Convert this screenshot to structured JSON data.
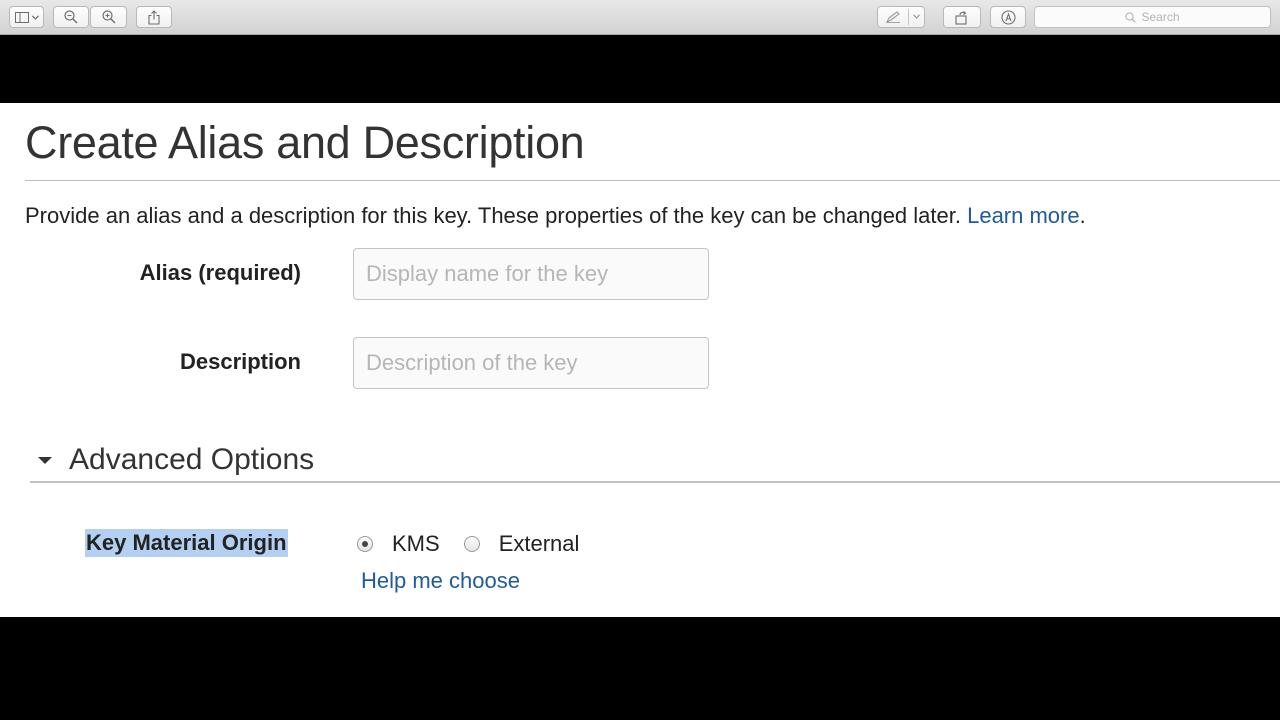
{
  "toolbar": {
    "icons": [
      "sidebar-icon",
      "chevron-down-icon",
      "zoom-out-icon",
      "zoom-in-icon",
      "share-icon",
      "markup-pen-icon",
      "rotate-icon",
      "annotate-icon"
    ],
    "search_placeholder": "Search"
  },
  "page": {
    "title": "Create Alias and Description",
    "intro_text": "Provide an alias and a description for this key. These properties of the key can be changed later. ",
    "learn_more_link": "Learn more",
    "intro_period": ".",
    "fields": {
      "alias_label": "Alias (required)",
      "alias_placeholder": "Display name for the key",
      "alias_value": "",
      "description_label": "Description",
      "description_placeholder": "Description of the key",
      "description_value": ""
    },
    "advanced": {
      "title": "Advanced Options",
      "expanded": true,
      "key_material_origin_label": "Key Material Origin",
      "options": [
        {
          "label": "KMS",
          "selected": true
        },
        {
          "label": "External",
          "selected": false
        }
      ],
      "help_link": "Help me choose"
    }
  },
  "colors": {
    "link": "#1f5b9c",
    "selection_highlight": "#b3d0f2",
    "title_text": "#333333"
  }
}
